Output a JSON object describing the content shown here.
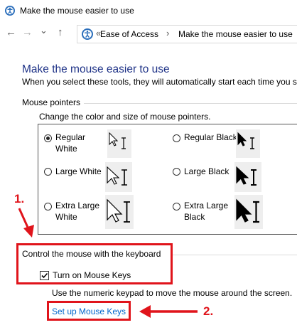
{
  "window": {
    "title": "Make the mouse easier to use"
  },
  "nav": {
    "back": "←",
    "forward": "→",
    "dropdown": "⌄",
    "up": "↑",
    "breadcrumb_prefix": "«",
    "crumbs": [
      "Ease of Access",
      "Make the mouse easier to use"
    ],
    "separator": "›"
  },
  "page": {
    "heading": "Make the mouse easier to use",
    "intro": "When you select these tools, they will automatically start each time you si"
  },
  "mouse_pointers": {
    "section_label": "Mouse pointers",
    "sub_label": "Change the color and size of mouse pointers.",
    "options": [
      {
        "label_line1": "Regular",
        "label_line2": "White",
        "selected": true
      },
      {
        "label_line1": "Regular Black",
        "label_line2": "",
        "selected": false
      },
      {
        "label_line1": "Large White",
        "label_line2": "",
        "selected": false
      },
      {
        "label_line1": "Large Black",
        "label_line2": "",
        "selected": false
      },
      {
        "label_line1": "Extra Large",
        "label_line2": "White",
        "selected": false
      },
      {
        "label_line1": "Extra Large",
        "label_line2": "Black",
        "selected": false
      }
    ]
  },
  "keyboard": {
    "section_label": "Control the mouse with the keyboard",
    "checkbox_label": "Turn on Mouse Keys",
    "checkbox_checked": true,
    "help_text": "Use the numeric keypad to move the mouse around the screen.",
    "link_text": "Set up Mouse Keys"
  },
  "annotations": {
    "step1": "1.",
    "step2": "2."
  },
  "colors": {
    "accent_red": "#e0141b",
    "heading_blue": "#1e3287",
    "link_blue": "#0066cc"
  }
}
